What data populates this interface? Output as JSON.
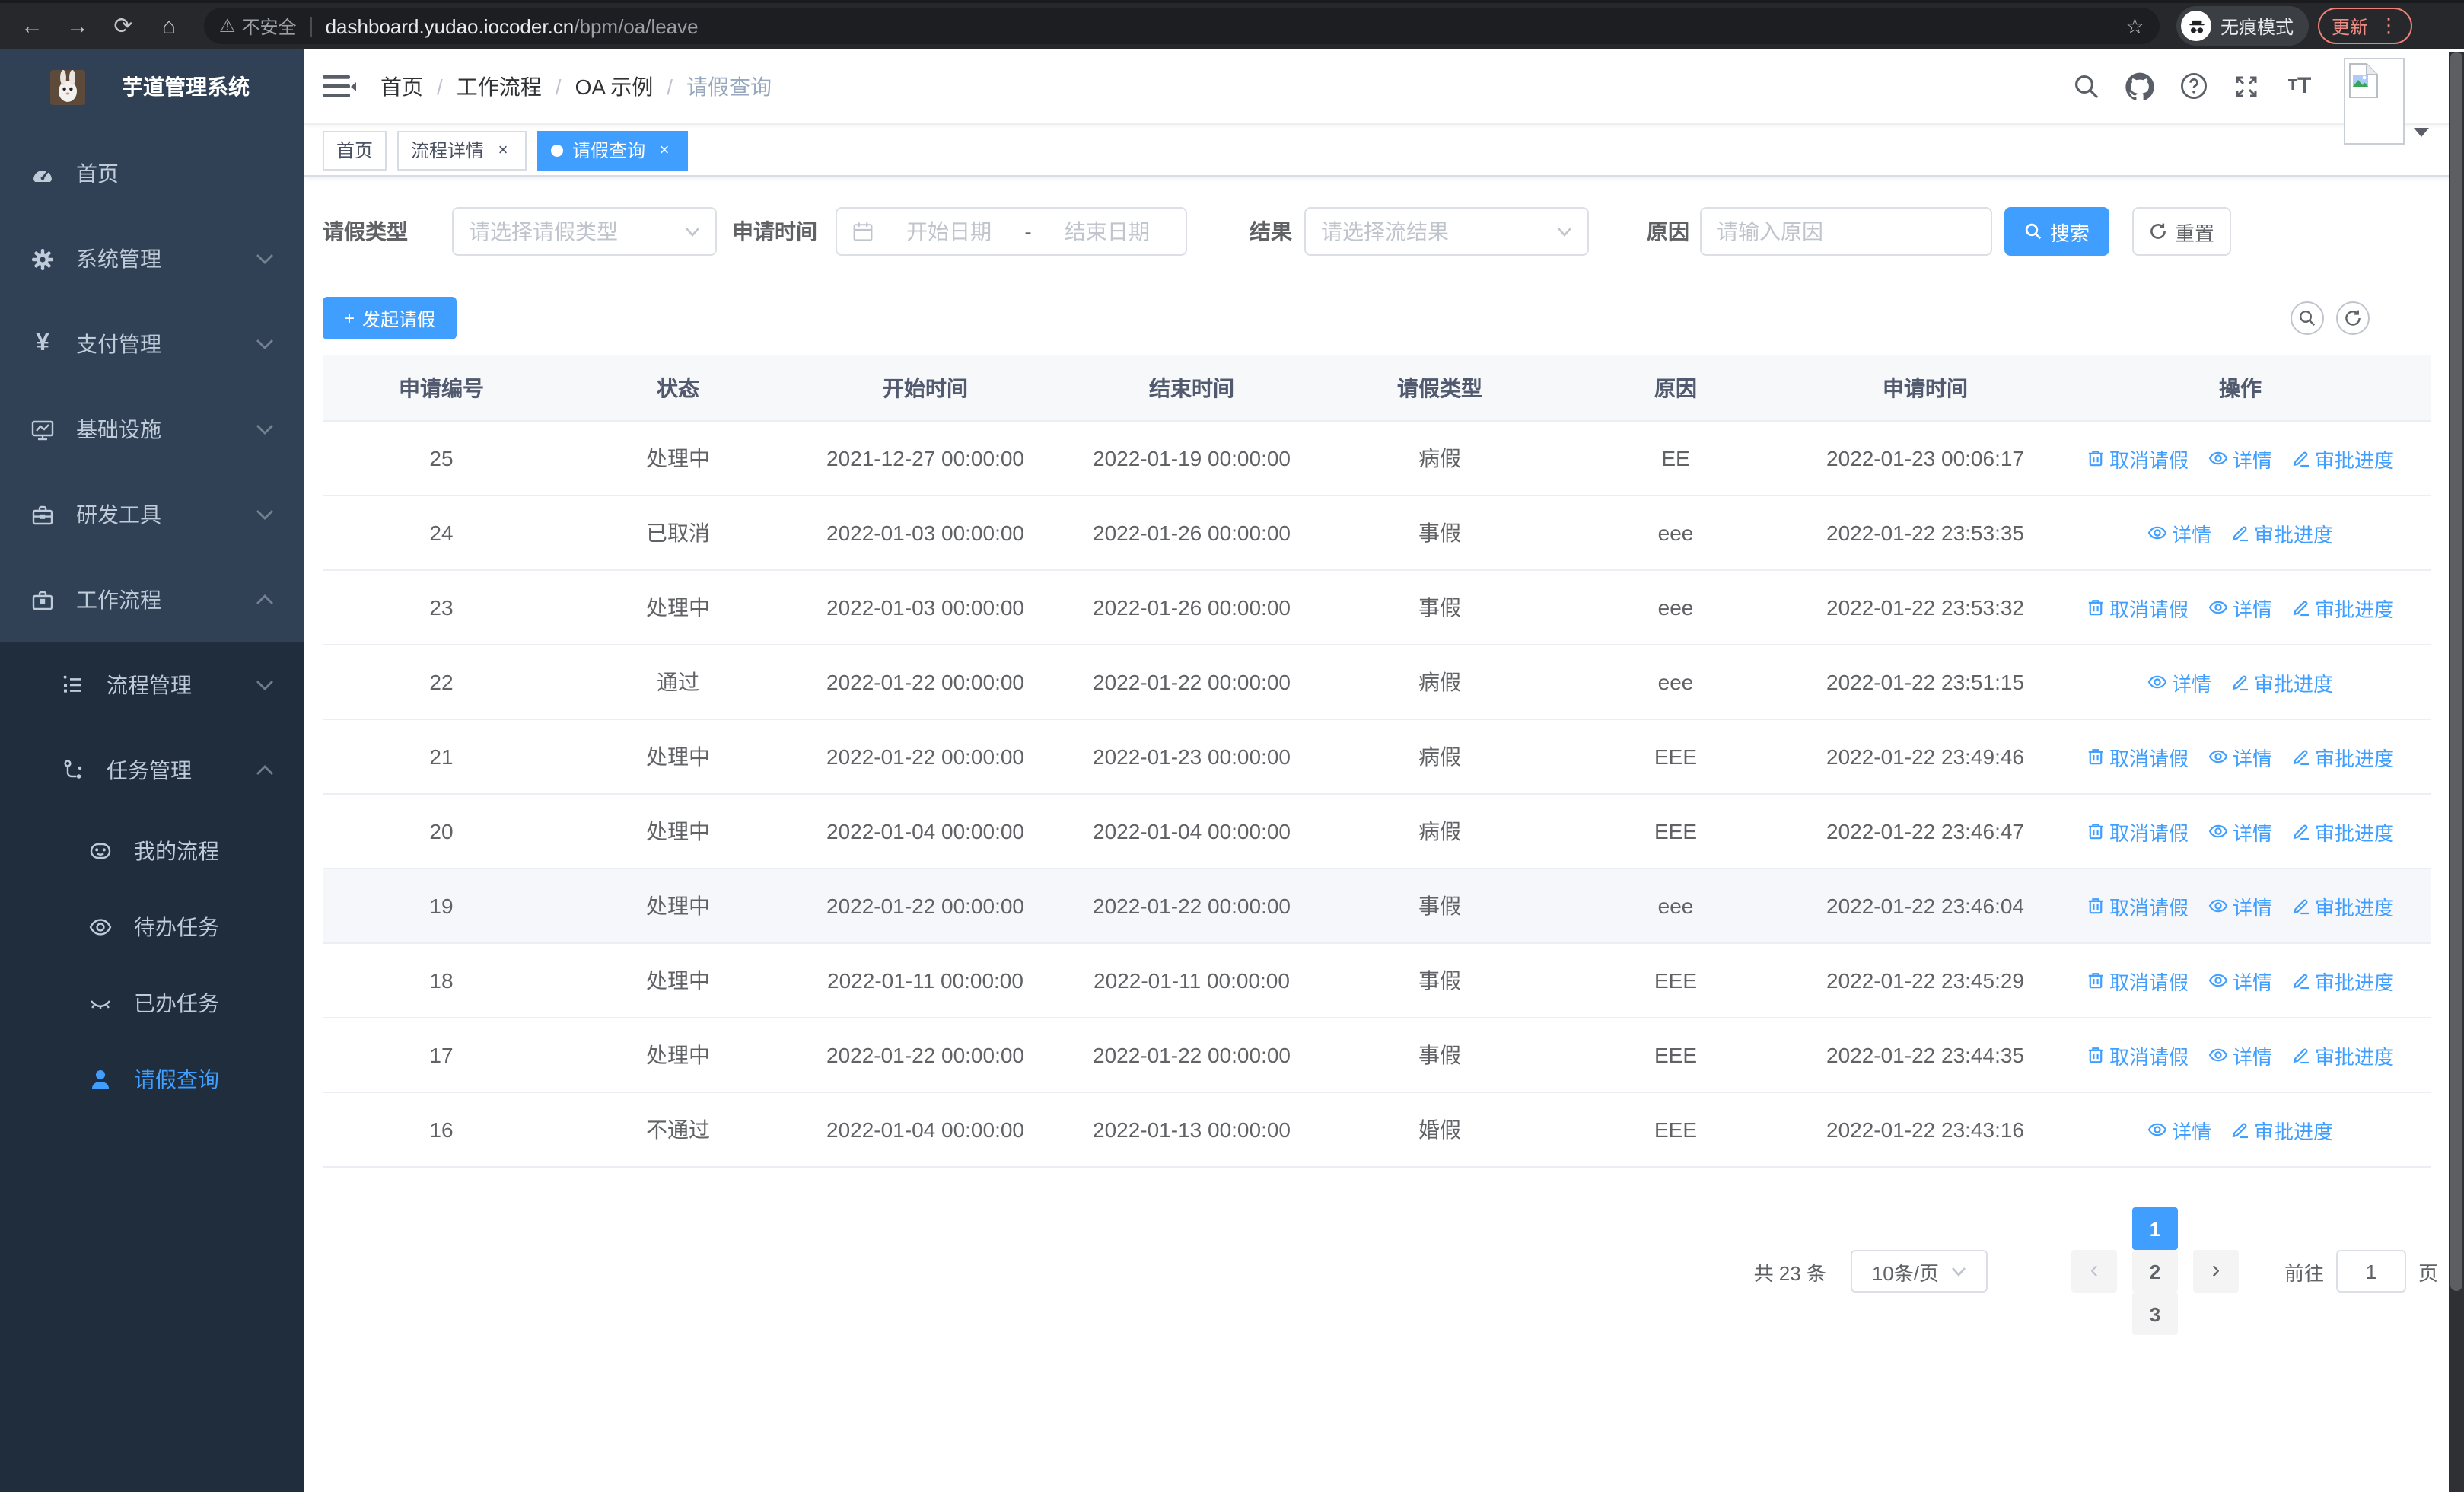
{
  "browser": {
    "back_icon": "←",
    "forward_icon": "→",
    "reload_icon": "⟳",
    "home_icon": "⌂",
    "warning_icon": "⚠",
    "security_label": "不安全",
    "url_host": "dashboard.yudao.iocoder.cn",
    "url_path": "/bpm/oa/leave",
    "star_icon": "☆",
    "incognito_label": "无痕模式",
    "update_label": "更新",
    "menu_dots_icon": "⋮"
  },
  "sidebar": {
    "title": "芋道管理系统",
    "items": [
      {
        "label": "首页"
      },
      {
        "label": "系统管理"
      },
      {
        "label": "支付管理"
      },
      {
        "label": "基础设施"
      },
      {
        "label": "研发工具"
      },
      {
        "label": "工作流程"
      },
      {
        "label": "流程管理"
      },
      {
        "label": "任务管理"
      },
      {
        "label": "我的流程"
      },
      {
        "label": "待办任务"
      },
      {
        "label": "已办任务"
      },
      {
        "label": "请假查询"
      }
    ],
    "yen_icon": "¥"
  },
  "breadcrumb": {
    "items": [
      "首页",
      "工作流程",
      "OA 示例",
      "请假查询"
    ],
    "separator": "/"
  },
  "tabs": [
    {
      "label": "首页"
    },
    {
      "label": "流程详情"
    },
    {
      "label": "请假查询"
    }
  ],
  "tab_close_icon": "×",
  "filters": {
    "leave_type_label": "请假类型",
    "leave_type_placeholder": "请选择请假类型",
    "apply_time_label": "申请时间",
    "start_date_placeholder": "开始日期",
    "range_separator": "-",
    "end_date_placeholder": "结束日期",
    "result_label": "结果",
    "result_placeholder": "请选择流结果",
    "reason_label": "原因",
    "reason_placeholder": "请输入原因",
    "search_label": "搜索",
    "reset_label": "重置"
  },
  "toolbar": {
    "create_label": "发起请假",
    "plus_icon": "+"
  },
  "table": {
    "columns": [
      "申请编号",
      "状态",
      "开始时间",
      "结束时间",
      "请假类型",
      "原因",
      "申请时间",
      "操作"
    ],
    "action_labels": {
      "cancel": "取消请假",
      "detail": "详情",
      "progress": "审批进度"
    },
    "rows": [
      {
        "id": "25",
        "status": "处理中",
        "start": "2021-12-27 00:00:00",
        "end": "2022-01-19 00:00:00",
        "type": "病假",
        "reason": "EE",
        "applyTime": "2022-01-23 00:06:17",
        "cancellable": true,
        "highlight": false
      },
      {
        "id": "24",
        "status": "已取消",
        "start": "2022-01-03 00:00:00",
        "end": "2022-01-26 00:00:00",
        "type": "事假",
        "reason": "eee",
        "applyTime": "2022-01-22 23:53:35",
        "cancellable": false,
        "highlight": false
      },
      {
        "id": "23",
        "status": "处理中",
        "start": "2022-01-03 00:00:00",
        "end": "2022-01-26 00:00:00",
        "type": "事假",
        "reason": "eee",
        "applyTime": "2022-01-22 23:53:32",
        "cancellable": true,
        "highlight": false
      },
      {
        "id": "22",
        "status": "通过",
        "start": "2022-01-22 00:00:00",
        "end": "2022-01-22 00:00:00",
        "type": "病假",
        "reason": "eee",
        "applyTime": "2022-01-22 23:51:15",
        "cancellable": false,
        "highlight": false
      },
      {
        "id": "21",
        "status": "处理中",
        "start": "2022-01-22 00:00:00",
        "end": "2022-01-23 00:00:00",
        "type": "病假",
        "reason": "EEE",
        "applyTime": "2022-01-22 23:49:46",
        "cancellable": true,
        "highlight": false
      },
      {
        "id": "20",
        "status": "处理中",
        "start": "2022-01-04 00:00:00",
        "end": "2022-01-04 00:00:00",
        "type": "病假",
        "reason": "EEE",
        "applyTime": "2022-01-22 23:46:47",
        "cancellable": true,
        "highlight": false
      },
      {
        "id": "19",
        "status": "处理中",
        "start": "2022-01-22 00:00:00",
        "end": "2022-01-22 00:00:00",
        "type": "事假",
        "reason": "eee",
        "applyTime": "2022-01-22 23:46:04",
        "cancellable": true,
        "highlight": true
      },
      {
        "id": "18",
        "status": "处理中",
        "start": "2022-01-11 00:00:00",
        "end": "2022-01-11 00:00:00",
        "type": "事假",
        "reason": "EEE",
        "applyTime": "2022-01-22 23:45:29",
        "cancellable": true,
        "highlight": false
      },
      {
        "id": "17",
        "status": "处理中",
        "start": "2022-01-22 00:00:00",
        "end": "2022-01-22 00:00:00",
        "type": "事假",
        "reason": "EEE",
        "applyTime": "2022-01-22 23:44:35",
        "cancellable": true,
        "highlight": false
      },
      {
        "id": "16",
        "status": "不通过",
        "start": "2022-01-04 00:00:00",
        "end": "2022-01-13 00:00:00",
        "type": "婚假",
        "reason": "EEE",
        "applyTime": "2022-01-22 23:43:16",
        "cancellable": false,
        "highlight": false
      }
    ]
  },
  "pagination": {
    "total_label": "共 23 条",
    "page_size_label": "10条/页",
    "prev_icon": "‹",
    "next_icon": "›",
    "pages": [
      "1",
      "2",
      "3"
    ],
    "active_page": "1",
    "goto_label": "前往",
    "goto_value": "1",
    "page_suffix": "页"
  },
  "colors": {
    "primary": "#409EFF",
    "sidebar_bg": "#304156",
    "submenu_bg": "#1f2d3d",
    "sidebar_text": "#bfcbd9",
    "chrome_bg": "#27282c",
    "update_accent": "#f28b82",
    "table_border": "#ebeef5",
    "header_bg": "#f7f8fa"
  }
}
